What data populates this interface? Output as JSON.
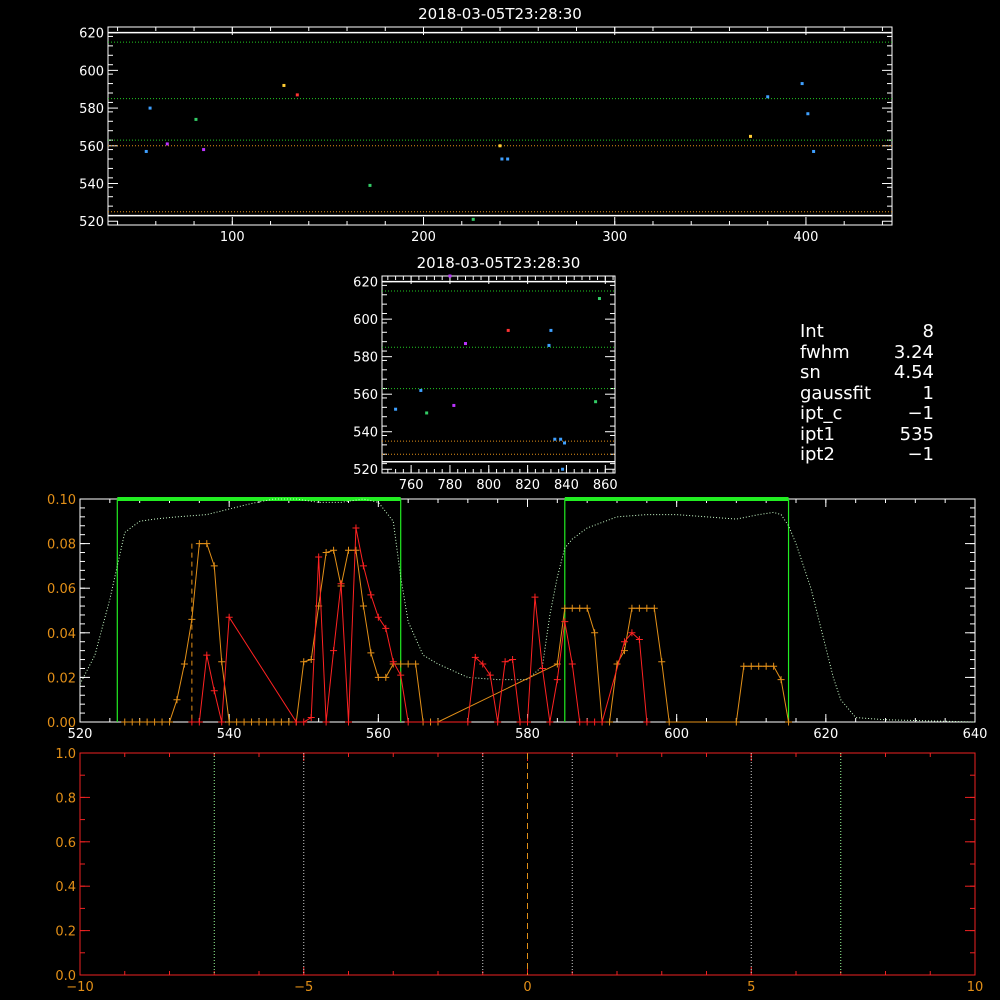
{
  "info_panel": [
    {
      "key": "Int",
      "value": "8"
    },
    {
      "key": "fwhm",
      "value": "3.24"
    },
    {
      "key": "sn",
      "value": "4.54"
    },
    {
      "key": "gaussfit",
      "value": "1"
    },
    {
      "key": "ipt_c",
      "value": "−1"
    },
    {
      "key": "ipt1",
      "value": "535"
    },
    {
      "key": "ipt2",
      "value": "−1"
    }
  ],
  "chart_data": [
    {
      "id": "scatter-top",
      "type": "scatter",
      "title": "2018-03-05T23:28:30",
      "xlabel": "",
      "ylabel": "",
      "xlim": [
        35,
        445
      ],
      "ylim": [
        518,
        623
      ],
      "xticks": [
        100,
        200,
        300,
        400
      ],
      "yticks": [
        520,
        540,
        560,
        580,
        600,
        620
      ],
      "colors": {
        "frame": "#ffffff",
        "line_green": "#22cc22",
        "line_orange": "#e39018",
        "line_white": "#ffffff"
      },
      "hlines": [
        {
          "y": 620,
          "style": "solid",
          "color": "#ffffff"
        },
        {
          "y": 615,
          "style": "dotted",
          "color": "#22cc22"
        },
        {
          "y": 585,
          "style": "dotted",
          "color": "#22cc22"
        },
        {
          "y": 563,
          "style": "dotted",
          "color": "#22cc22"
        },
        {
          "y": 560,
          "style": "dotted",
          "color": "#e39018"
        },
        {
          "y": 525,
          "style": "dotted",
          "color": "#e39018"
        },
        {
          "y": 523,
          "style": "solid",
          "color": "#ffffff"
        }
      ],
      "points": [
        {
          "x": 55,
          "y": 557,
          "color": "#3fa0ff"
        },
        {
          "x": 57,
          "y": 580,
          "color": "#3fa0ff"
        },
        {
          "x": 66,
          "y": 561,
          "color": "#bb33ff"
        },
        {
          "x": 81,
          "y": 574,
          "color": "#33cc66"
        },
        {
          "x": 85,
          "y": 558,
          "color": "#bb33ff"
        },
        {
          "x": 127,
          "y": 592,
          "color": "#ffcc33"
        },
        {
          "x": 134,
          "y": 587,
          "color": "#ff3333"
        },
        {
          "x": 172,
          "y": 539,
          "color": "#33cc66"
        },
        {
          "x": 226,
          "y": 521,
          "color": "#33cc66"
        },
        {
          "x": 240,
          "y": 560,
          "color": "#ffcc33"
        },
        {
          "x": 241,
          "y": 553,
          "color": "#3fa0ff"
        },
        {
          "x": 244,
          "y": 553,
          "color": "#3fa0ff"
        },
        {
          "x": 371,
          "y": 565,
          "color": "#ffcc33"
        },
        {
          "x": 380,
          "y": 586,
          "color": "#3fa0ff"
        },
        {
          "x": 398,
          "y": 593,
          "color": "#3fa0ff"
        },
        {
          "x": 401,
          "y": 577,
          "color": "#3fa0ff"
        },
        {
          "x": 404,
          "y": 557,
          "color": "#3fa0ff"
        }
      ]
    },
    {
      "id": "scatter-mid",
      "type": "scatter",
      "title": "2018-03-05T23:28:30",
      "xlabel": "",
      "ylabel": "",
      "xlim": [
        745,
        865
      ],
      "ylim": [
        518,
        623
      ],
      "xticks": [
        760,
        780,
        800,
        820,
        840,
        860
      ],
      "yticks": [
        520,
        540,
        560,
        580,
        600,
        620
      ],
      "colors": {
        "frame": "#ffffff"
      },
      "hlines": [
        {
          "y": 620,
          "style": "solid",
          "color": "#ffffff"
        },
        {
          "y": 615,
          "style": "dotted",
          "color": "#22cc22"
        },
        {
          "y": 585,
          "style": "dotted",
          "color": "#22cc22"
        },
        {
          "y": 563,
          "style": "dotted",
          "color": "#22cc22"
        },
        {
          "y": 535,
          "style": "dotted",
          "color": "#e39018"
        },
        {
          "y": 528,
          "style": "dotted",
          "color": "#e39018"
        },
        {
          "y": 524,
          "style": "solid",
          "color": "#ffffff"
        }
      ],
      "points": [
        {
          "x": 752,
          "y": 552,
          "color": "#3fa0ff"
        },
        {
          "x": 765,
          "y": 562,
          "color": "#3fa0ff"
        },
        {
          "x": 768,
          "y": 550,
          "color": "#33cc66"
        },
        {
          "x": 780,
          "y": 623,
          "color": "#bb33ff"
        },
        {
          "x": 782,
          "y": 554,
          "color": "#bb33ff"
        },
        {
          "x": 788,
          "y": 587,
          "color": "#bb33ff"
        },
        {
          "x": 810,
          "y": 594,
          "color": "#ff3333"
        },
        {
          "x": 831,
          "y": 586,
          "color": "#3fa0ff"
        },
        {
          "x": 832,
          "y": 594,
          "color": "#3fa0ff"
        },
        {
          "x": 834,
          "y": 536,
          "color": "#3fa0ff"
        },
        {
          "x": 837,
          "y": 536,
          "color": "#3fa0ff"
        },
        {
          "x": 839,
          "y": 534,
          "color": "#3fa0ff"
        },
        {
          "x": 838,
          "y": 520,
          "color": "#3fa0ff"
        },
        {
          "x": 855,
          "y": 556,
          "color": "#33cc66"
        },
        {
          "x": 857,
          "y": 611,
          "color": "#33cc66"
        }
      ]
    },
    {
      "id": "spectrum",
      "type": "line",
      "title": "",
      "xlabel": "",
      "ylabel": "",
      "xlim": [
        520,
        640
      ],
      "ylim": [
        0,
        1.0
      ],
      "xticks": [
        520,
        540,
        560,
        580,
        600,
        620,
        640
      ],
      "yticks": [
        0.0,
        0.2,
        0.4,
        0.6,
        0.8,
        1.0
      ],
      "ytick_labels": [
        "0.00",
        "0.02",
        "0.04",
        "0.06",
        "0.08",
        "0.10"
      ],
      "colors": {
        "axis": "#ffffff",
        "ytick": "#e39018",
        "green": "#22ee22",
        "orange": "#e39018",
        "red": "#ff2222",
        "dotted": "#ccffcc"
      },
      "green_boxes": [
        [
          525,
          563
        ],
        [
          585,
          615
        ]
      ],
      "vline_dashed": 535,
      "series": [
        {
          "style": "dotted",
          "color": "#ccffcc",
          "x": [
            520,
            522,
            524,
            526,
            528,
            530,
            533,
            537,
            540,
            543,
            546,
            549,
            552,
            555,
            558,
            560,
            562,
            563,
            564,
            566,
            568,
            572,
            576,
            580,
            582,
            583,
            584,
            585,
            586,
            588,
            592,
            596,
            600,
            604,
            608,
            611,
            613,
            614,
            615,
            616,
            618,
            621,
            622,
            624,
            628,
            634,
            640
          ],
          "values": [
            0.17,
            0.3,
            0.55,
            0.85,
            0.9,
            0.91,
            0.92,
            0.93,
            0.955,
            0.98,
            1.0,
            1.0,
            0.985,
            0.985,
            1.0,
            0.985,
            0.9,
            0.65,
            0.45,
            0.3,
            0.26,
            0.2,
            0.19,
            0.19,
            0.25,
            0.48,
            0.65,
            0.78,
            0.82,
            0.87,
            0.92,
            0.93,
            0.93,
            0.92,
            0.91,
            0.93,
            0.94,
            0.93,
            0.88,
            0.8,
            0.6,
            0.2,
            0.1,
            0.02,
            0.01,
            0.005,
            0.0
          ]
        },
        {
          "style": "solid-plus",
          "color": "#e39018",
          "x": [
            526,
            527,
            528,
            529,
            530,
            531,
            532,
            533,
            534,
            535,
            536,
            537,
            538,
            539,
            540,
            541,
            542,
            543,
            544,
            545,
            546,
            547,
            548,
            549,
            550,
            551,
            552,
            553,
            554,
            555,
            556,
            557,
            558,
            559,
            560,
            561,
            562,
            563,
            564,
            565,
            566,
            567,
            568,
            584,
            585,
            586,
            587,
            588,
            589,
            590,
            591,
            592,
            593,
            594,
            595,
            596,
            597,
            598,
            599,
            608,
            609,
            610,
            611,
            612,
            613,
            614,
            615
          ],
          "values": [
            0.0,
            0.0,
            0.0,
            0.0,
            0.0,
            0.0,
            0.0,
            0.1,
            0.26,
            0.46,
            0.8,
            0.8,
            0.7,
            0.27,
            0.0,
            0.0,
            0.0,
            0.0,
            0.0,
            0.0,
            0.0,
            0.0,
            0.0,
            0.0,
            0.27,
            0.28,
            0.52,
            0.76,
            0.77,
            0.61,
            0.77,
            0.77,
            0.52,
            0.31,
            0.2,
            0.2,
            0.26,
            0.26,
            0.26,
            0.26,
            0.0,
            0.0,
            0.0,
            0.26,
            0.51,
            0.51,
            0.51,
            0.51,
            0.4,
            0.0,
            0.0,
            0.26,
            0.32,
            0.51,
            0.51,
            0.51,
            0.51,
            0.27,
            0.0,
            0.0,
            0.25,
            0.25,
            0.25,
            0.25,
            0.25,
            0.19,
            0.0
          ]
        },
        {
          "style": "solid-plus",
          "color": "#ff2222",
          "x": [
            535,
            536,
            537,
            538,
            539,
            540,
            549,
            550,
            551,
            552,
            553,
            554,
            555,
            556,
            557,
            558,
            559,
            560,
            561,
            562,
            563,
            564,
            572,
            573,
            574,
            575,
            576,
            577,
            578,
            579,
            580,
            581,
            582,
            583,
            584,
            585,
            586,
            587,
            588,
            589,
            590,
            593,
            594,
            595,
            596
          ],
          "values": [
            0.0,
            0.0,
            0.3,
            0.14,
            0.0,
            0.47,
            0.0,
            0.0,
            0.02,
            0.74,
            0.0,
            0.32,
            0.62,
            0.0,
            0.87,
            0.7,
            0.57,
            0.47,
            0.42,
            0.27,
            0.21,
            0.0,
            0.0,
            0.29,
            0.26,
            0.21,
            0.0,
            0.27,
            0.28,
            0.0,
            0.0,
            0.56,
            0.24,
            0.0,
            0.19,
            0.45,
            0.26,
            0.0,
            0.0,
            0.0,
            0.0,
            0.36,
            0.4,
            0.37,
            0.0
          ]
        }
      ]
    },
    {
      "id": "lower-panel",
      "type": "line",
      "title": "",
      "xlabel": "",
      "ylabel": "",
      "xlim": [
        -10,
        10
      ],
      "ylim": [
        0,
        1.0
      ],
      "xticks": [
        -10,
        -5,
        0,
        5,
        10
      ],
      "yticks": [
        0.0,
        0.2,
        0.4,
        0.6,
        0.8,
        1.0
      ],
      "ytick_labels": [
        "0.0",
        "0.2",
        "0.4",
        "0.6",
        "0.8",
        "1.0"
      ],
      "colors": {
        "axis": "#ee2222",
        "green_dotted": "#99ff99",
        "white_dotted": "#cccccc",
        "orange": "#e39018"
      },
      "green_dotted_x": [
        -7,
        7
      ],
      "white_dotted_x": [
        -5,
        -1,
        1,
        5
      ],
      "orange_dashed_x": 0
    }
  ]
}
